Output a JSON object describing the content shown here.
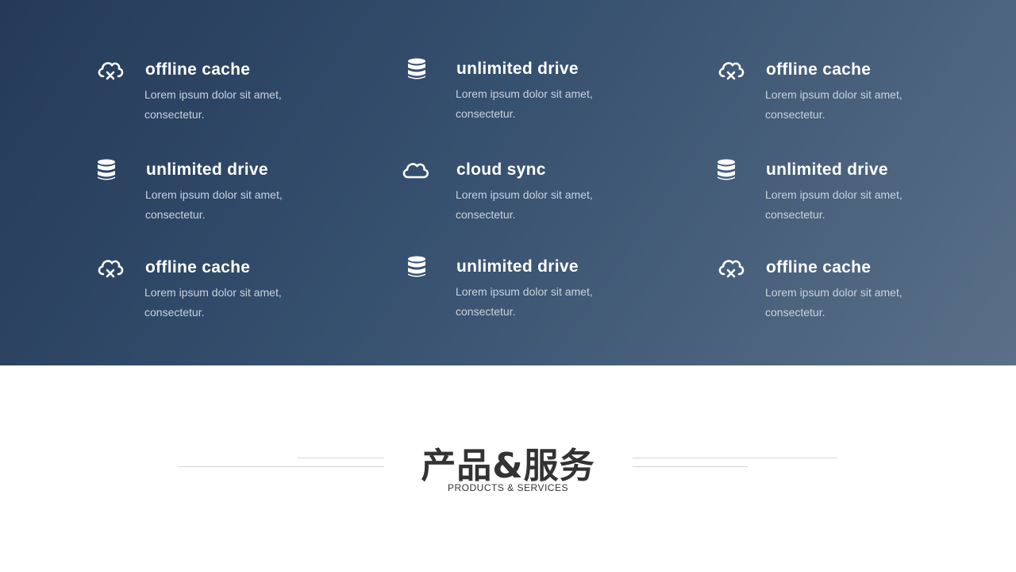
{
  "features": [
    {
      "icon": "cloud-offline-icon",
      "title": "offline cache",
      "desc": "Lorem ipsum dolor sit amet, consectetur."
    },
    {
      "icon": "database-icon",
      "title": "unlimited drive",
      "desc": "Lorem ipsum dolor sit amet, consectetur."
    },
    {
      "icon": "cloud-offline-icon",
      "title": "offline cache",
      "desc": "Lorem ipsum dolor sit amet, consectetur."
    },
    {
      "icon": "database-icon",
      "title": "unlimited drive",
      "desc": "Lorem ipsum dolor sit amet, consectetur."
    },
    {
      "icon": "cloud-icon",
      "title": "cloud sync",
      "desc": "Lorem ipsum dolor sit amet, consectetur."
    },
    {
      "icon": "database-icon",
      "title": "unlimited drive",
      "desc": "Lorem ipsum dolor sit amet, consectetur."
    },
    {
      "icon": "cloud-offline-icon",
      "title": "offline cache",
      "desc": "Lorem ipsum dolor sit amet, consectetur."
    },
    {
      "icon": "database-icon",
      "title": "unlimited drive",
      "desc": "Lorem ipsum dolor sit amet, consectetur."
    },
    {
      "icon": "cloud-offline-icon",
      "title": "offline cache",
      "desc": "Lorem ipsum dolor sit amet, consectetur."
    }
  ],
  "section": {
    "title": "产品&服务",
    "subtitle": "PRODUCTS & SERVICES"
  },
  "colors": {
    "gradient_start": "#243a58",
    "gradient_end": "#5a7088",
    "title_text": "#ffffff",
    "heading_text": "#333333"
  }
}
